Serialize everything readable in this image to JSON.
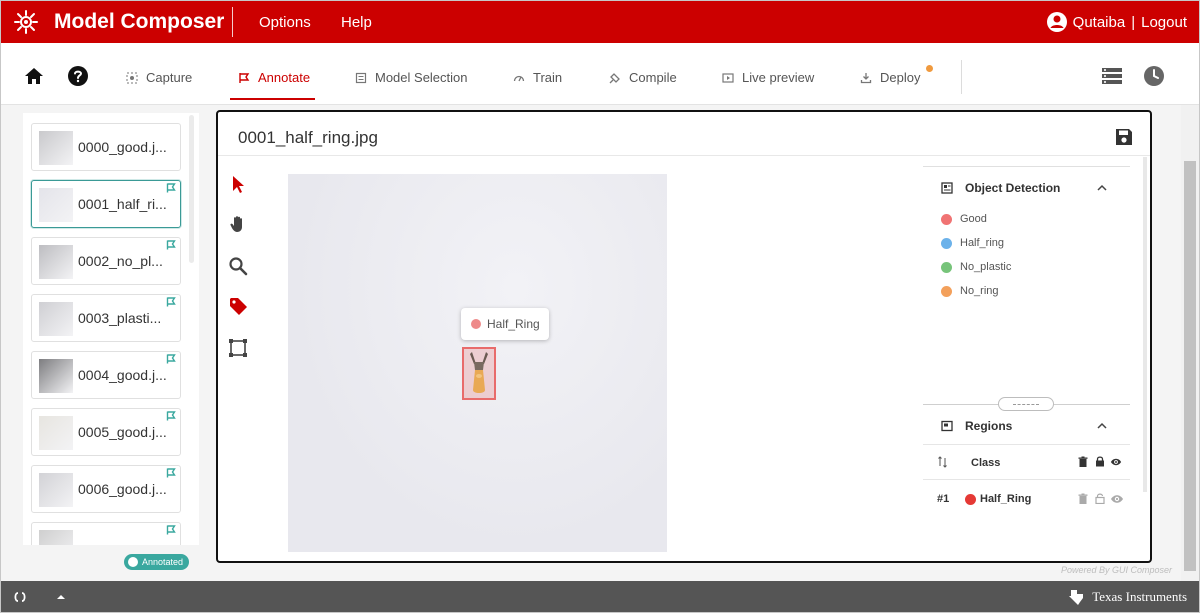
{
  "header": {
    "app_title": "Model Composer",
    "menu": [
      "Options",
      "Help"
    ],
    "user_name": "Qutaiba",
    "separator": "|",
    "logout": "Logout",
    "brand_color": "#cc0000"
  },
  "toolbar": {
    "tabs": [
      {
        "label": "Capture",
        "icon": "capture-icon"
      },
      {
        "label": "Annotate",
        "icon": "annotate-icon",
        "active": true
      },
      {
        "label": "Model Selection",
        "icon": "model-selection-icon"
      },
      {
        "label": "Train",
        "icon": "train-icon"
      },
      {
        "label": "Compile",
        "icon": "compile-icon"
      },
      {
        "label": "Live preview",
        "icon": "live-preview-icon"
      },
      {
        "label": "Deploy",
        "icon": "deploy-icon"
      }
    ],
    "left_icons": [
      "home-icon",
      "help-icon"
    ],
    "right_icons": [
      "list-view-icon",
      "history-icon"
    ]
  },
  "image_list": {
    "items": [
      {
        "label": "0000_good.j...",
        "annotated": false
      },
      {
        "label": "0001_half_ri...",
        "annotated": true,
        "selected": true
      },
      {
        "label": "0002_no_pl...",
        "annotated": true
      },
      {
        "label": "0003_plasti...",
        "annotated": true
      },
      {
        "label": "0004_good.j...",
        "annotated": true
      },
      {
        "label": "0005_good.j...",
        "annotated": true
      },
      {
        "label": "0006_good.j...",
        "annotated": true
      },
      {
        "label": "",
        "annotated": true
      }
    ],
    "legend_badge": "Annotated",
    "annotated_color": "#3aa89f"
  },
  "workspace": {
    "filename": "0001_half_ring.jpg",
    "tools": [
      "select-icon",
      "pan-icon",
      "zoom-icon",
      "tag-icon",
      "bounding-box-icon"
    ],
    "region_label": "Half_Ring",
    "region_color": "#e86b6b"
  },
  "object_detection": {
    "title": "Object Detection",
    "classes": [
      {
        "name": "Good",
        "color": "#f07373"
      },
      {
        "name": "Half_ring",
        "color": "#6cb2ea"
      },
      {
        "name": "No_plastic",
        "color": "#77c47a"
      },
      {
        "name": "No_ring",
        "color": "#f3a05b"
      }
    ]
  },
  "regions": {
    "title": "Regions",
    "column_class": "Class",
    "rows": [
      {
        "id": "#1",
        "class": "Half_Ring",
        "color": "#e53935"
      }
    ]
  },
  "footer": {
    "powered_by": "Powered By GUI Composer",
    "brand": "Texas Instruments"
  }
}
